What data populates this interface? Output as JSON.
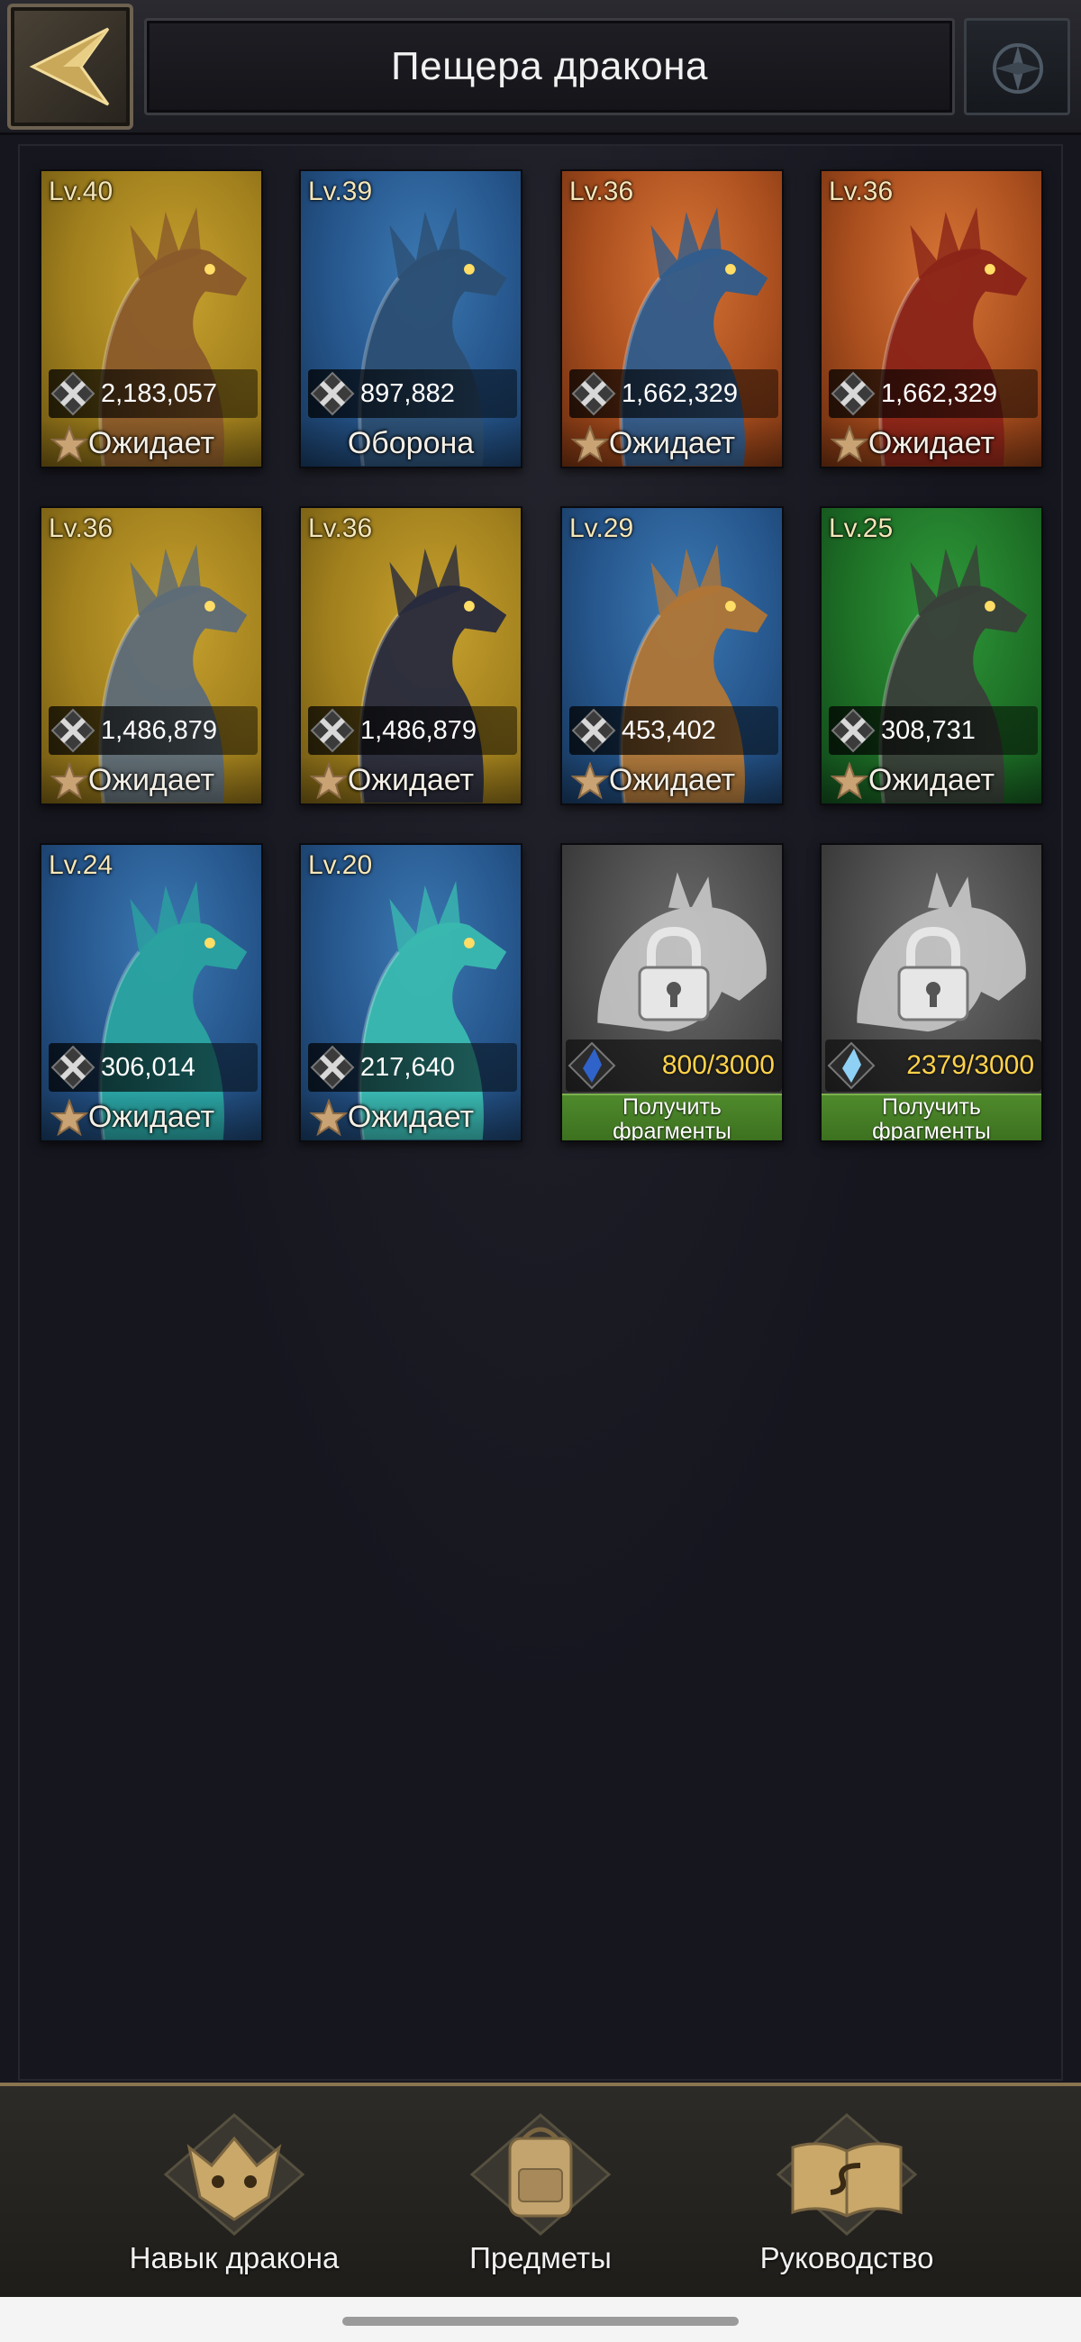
{
  "header": {
    "title": "Пещера дракона",
    "back_icon": "arrow-left-icon",
    "menu_icon": "ornament-icon"
  },
  "dragons": [
    {
      "level": "Lv.40",
      "power": "2,183,057",
      "status": "Ожидает",
      "bg": "gold",
      "color": "#8a5a2a"
    },
    {
      "level": "Lv.39",
      "power": "897,882",
      "status": "Оборона",
      "bg": "blue",
      "color": "#2c4f73"
    },
    {
      "level": "Lv.36",
      "power": "1,662,329",
      "status": "Ожидает",
      "bg": "orange",
      "color": "#2f5c8c"
    },
    {
      "level": "Lv.36",
      "power": "1,662,329",
      "status": "Ожидает",
      "bg": "orange",
      "color": "#8a2418"
    },
    {
      "level": "Lv.36",
      "power": "1,486,879",
      "status": "Ожидает",
      "bg": "gold",
      "color": "#5d6b78"
    },
    {
      "level": "Lv.36",
      "power": "1,486,879",
      "status": "Ожидает",
      "bg": "gold",
      "color": "#272a3d"
    },
    {
      "level": "Lv.29",
      "power": "453,402",
      "status": "Ожидает",
      "bg": "blue",
      "color": "#b07636"
    },
    {
      "level": "Lv.25",
      "power": "308,731",
      "status": "Ожидает",
      "bg": "green",
      "color": "#3a3f3a"
    },
    {
      "level": "Lv.24",
      "power": "306,014",
      "status": "Ожидает",
      "bg": "blue",
      "color": "#2aa3a0"
    },
    {
      "level": "Lv.20",
      "power": "217,640",
      "status": "Ожидает",
      "bg": "blue",
      "color": "#3ab9b0"
    }
  ],
  "locked": [
    {
      "fragments": "800/3000",
      "button": "Получить\nфрагменты",
      "crystal_color": "#2f63c9"
    },
    {
      "fragments": "2379/3000",
      "button": "Получить\nфрагменты",
      "crystal_color": "#8fd0f5"
    }
  ],
  "bottom_nav": [
    {
      "label": "Навык дракона",
      "icon": "dragon-skill-icon"
    },
    {
      "label": "Предметы",
      "icon": "backpack-icon"
    },
    {
      "label": "Руководство",
      "icon": "guide-book-icon"
    }
  ],
  "colors": {
    "gold_text": "#ffd24a",
    "green_button": "#4f8a2c",
    "nav_border": "#8a7550"
  }
}
